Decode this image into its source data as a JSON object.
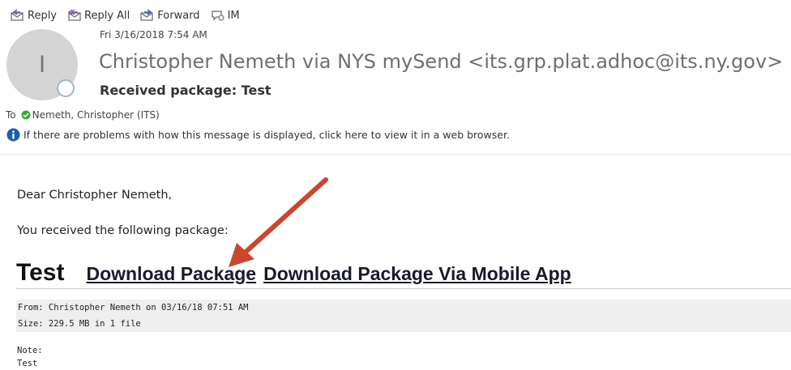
{
  "toolbar": {
    "reply": "Reply",
    "reply_all": "Reply All",
    "forward": "Forward",
    "im": "IM"
  },
  "header": {
    "avatar_initial": "I",
    "date": "Fri 3/16/2018 7:54 AM",
    "sender": "Christopher Nemeth via NYS mySend <its.grp.plat.adhoc@its.ny.gov>",
    "subject": "Received package: Test",
    "to_label": "To",
    "to_recipient": "Nemeth, Christopher (ITS)",
    "info_text": "If there are problems with how this message is displayed, click here to view it in a web browser."
  },
  "body": {
    "greeting": "Dear Christopher Nemeth,",
    "intro": "You received the following package:",
    "package_name": "Test",
    "download_link": "Download Package",
    "download_mobile_link": "Download Package Via Mobile App",
    "from_line": "From: Christopher Nemeth on 03/16/18 07:51 AM",
    "size_line": "Size: 229.5 MB in 1 file",
    "note_label": "Note:",
    "note_text": "Test"
  },
  "colors": {
    "annotation_arrow": "#c8472f",
    "presence_ring": "#9fb8c7",
    "check_green": "#3aa63a",
    "info_blue": "#1f5fa8"
  }
}
